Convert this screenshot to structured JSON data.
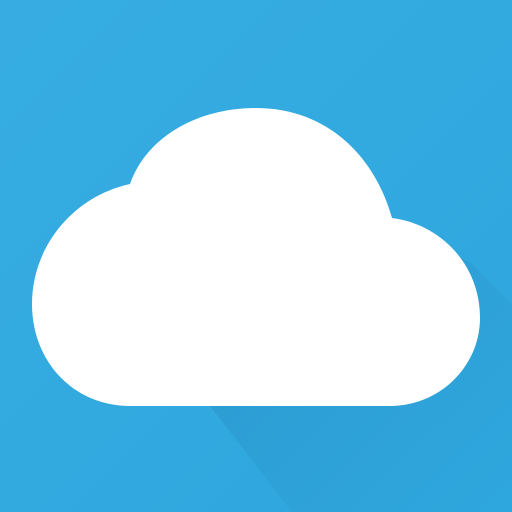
{
  "icon": {
    "name": "cloud-icon",
    "colors": {
      "background": "#2ea7de",
      "background_highlight": "#36ace2",
      "long_shadow": "#268fc6",
      "cloud": "#ffffff"
    }
  }
}
